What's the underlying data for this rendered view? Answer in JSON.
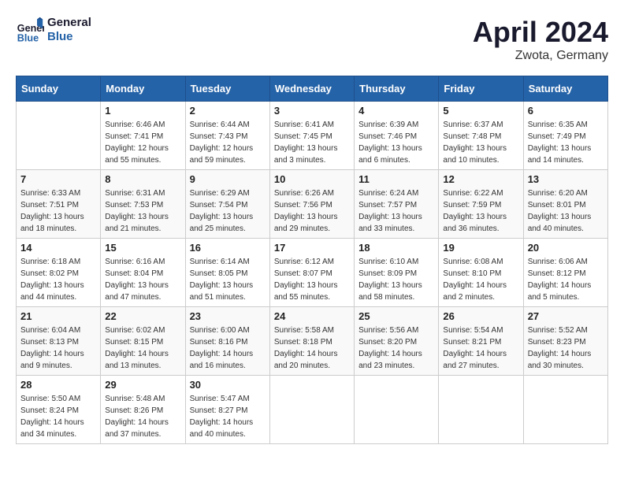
{
  "header": {
    "logo_line1": "General",
    "logo_line2": "Blue",
    "month_title": "April 2024",
    "location": "Zwota, Germany"
  },
  "days_of_week": [
    "Sunday",
    "Monday",
    "Tuesday",
    "Wednesday",
    "Thursday",
    "Friday",
    "Saturday"
  ],
  "weeks": [
    [
      {
        "day": "",
        "sunrise": "",
        "sunset": "",
        "daylight": ""
      },
      {
        "day": "1",
        "sunrise": "Sunrise: 6:46 AM",
        "sunset": "Sunset: 7:41 PM",
        "daylight": "Daylight: 12 hours and 55 minutes."
      },
      {
        "day": "2",
        "sunrise": "Sunrise: 6:44 AM",
        "sunset": "Sunset: 7:43 PM",
        "daylight": "Daylight: 12 hours and 59 minutes."
      },
      {
        "day": "3",
        "sunrise": "Sunrise: 6:41 AM",
        "sunset": "Sunset: 7:45 PM",
        "daylight": "Daylight: 13 hours and 3 minutes."
      },
      {
        "day": "4",
        "sunrise": "Sunrise: 6:39 AM",
        "sunset": "Sunset: 7:46 PM",
        "daylight": "Daylight: 13 hours and 6 minutes."
      },
      {
        "day": "5",
        "sunrise": "Sunrise: 6:37 AM",
        "sunset": "Sunset: 7:48 PM",
        "daylight": "Daylight: 13 hours and 10 minutes."
      },
      {
        "day": "6",
        "sunrise": "Sunrise: 6:35 AM",
        "sunset": "Sunset: 7:49 PM",
        "daylight": "Daylight: 13 hours and 14 minutes."
      }
    ],
    [
      {
        "day": "7",
        "sunrise": "Sunrise: 6:33 AM",
        "sunset": "Sunset: 7:51 PM",
        "daylight": "Daylight: 13 hours and 18 minutes."
      },
      {
        "day": "8",
        "sunrise": "Sunrise: 6:31 AM",
        "sunset": "Sunset: 7:53 PM",
        "daylight": "Daylight: 13 hours and 21 minutes."
      },
      {
        "day": "9",
        "sunrise": "Sunrise: 6:29 AM",
        "sunset": "Sunset: 7:54 PM",
        "daylight": "Daylight: 13 hours and 25 minutes."
      },
      {
        "day": "10",
        "sunrise": "Sunrise: 6:26 AM",
        "sunset": "Sunset: 7:56 PM",
        "daylight": "Daylight: 13 hours and 29 minutes."
      },
      {
        "day": "11",
        "sunrise": "Sunrise: 6:24 AM",
        "sunset": "Sunset: 7:57 PM",
        "daylight": "Daylight: 13 hours and 33 minutes."
      },
      {
        "day": "12",
        "sunrise": "Sunrise: 6:22 AM",
        "sunset": "Sunset: 7:59 PM",
        "daylight": "Daylight: 13 hours and 36 minutes."
      },
      {
        "day": "13",
        "sunrise": "Sunrise: 6:20 AM",
        "sunset": "Sunset: 8:01 PM",
        "daylight": "Daylight: 13 hours and 40 minutes."
      }
    ],
    [
      {
        "day": "14",
        "sunrise": "Sunrise: 6:18 AM",
        "sunset": "Sunset: 8:02 PM",
        "daylight": "Daylight: 13 hours and 44 minutes."
      },
      {
        "day": "15",
        "sunrise": "Sunrise: 6:16 AM",
        "sunset": "Sunset: 8:04 PM",
        "daylight": "Daylight: 13 hours and 47 minutes."
      },
      {
        "day": "16",
        "sunrise": "Sunrise: 6:14 AM",
        "sunset": "Sunset: 8:05 PM",
        "daylight": "Daylight: 13 hours and 51 minutes."
      },
      {
        "day": "17",
        "sunrise": "Sunrise: 6:12 AM",
        "sunset": "Sunset: 8:07 PM",
        "daylight": "Daylight: 13 hours and 55 minutes."
      },
      {
        "day": "18",
        "sunrise": "Sunrise: 6:10 AM",
        "sunset": "Sunset: 8:09 PM",
        "daylight": "Daylight: 13 hours and 58 minutes."
      },
      {
        "day": "19",
        "sunrise": "Sunrise: 6:08 AM",
        "sunset": "Sunset: 8:10 PM",
        "daylight": "Daylight: 14 hours and 2 minutes."
      },
      {
        "day": "20",
        "sunrise": "Sunrise: 6:06 AM",
        "sunset": "Sunset: 8:12 PM",
        "daylight": "Daylight: 14 hours and 5 minutes."
      }
    ],
    [
      {
        "day": "21",
        "sunrise": "Sunrise: 6:04 AM",
        "sunset": "Sunset: 8:13 PM",
        "daylight": "Daylight: 14 hours and 9 minutes."
      },
      {
        "day": "22",
        "sunrise": "Sunrise: 6:02 AM",
        "sunset": "Sunset: 8:15 PM",
        "daylight": "Daylight: 14 hours and 13 minutes."
      },
      {
        "day": "23",
        "sunrise": "Sunrise: 6:00 AM",
        "sunset": "Sunset: 8:16 PM",
        "daylight": "Daylight: 14 hours and 16 minutes."
      },
      {
        "day": "24",
        "sunrise": "Sunrise: 5:58 AM",
        "sunset": "Sunset: 8:18 PM",
        "daylight": "Daylight: 14 hours and 20 minutes."
      },
      {
        "day": "25",
        "sunrise": "Sunrise: 5:56 AM",
        "sunset": "Sunset: 8:20 PM",
        "daylight": "Daylight: 14 hours and 23 minutes."
      },
      {
        "day": "26",
        "sunrise": "Sunrise: 5:54 AM",
        "sunset": "Sunset: 8:21 PM",
        "daylight": "Daylight: 14 hours and 27 minutes."
      },
      {
        "day": "27",
        "sunrise": "Sunrise: 5:52 AM",
        "sunset": "Sunset: 8:23 PM",
        "daylight": "Daylight: 14 hours and 30 minutes."
      }
    ],
    [
      {
        "day": "28",
        "sunrise": "Sunrise: 5:50 AM",
        "sunset": "Sunset: 8:24 PM",
        "daylight": "Daylight: 14 hours and 34 minutes."
      },
      {
        "day": "29",
        "sunrise": "Sunrise: 5:48 AM",
        "sunset": "Sunset: 8:26 PM",
        "daylight": "Daylight: 14 hours and 37 minutes."
      },
      {
        "day": "30",
        "sunrise": "Sunrise: 5:47 AM",
        "sunset": "Sunset: 8:27 PM",
        "daylight": "Daylight: 14 hours and 40 minutes."
      },
      {
        "day": "",
        "sunrise": "",
        "sunset": "",
        "daylight": ""
      },
      {
        "day": "",
        "sunrise": "",
        "sunset": "",
        "daylight": ""
      },
      {
        "day": "",
        "sunrise": "",
        "sunset": "",
        "daylight": ""
      },
      {
        "day": "",
        "sunrise": "",
        "sunset": "",
        "daylight": ""
      }
    ]
  ]
}
